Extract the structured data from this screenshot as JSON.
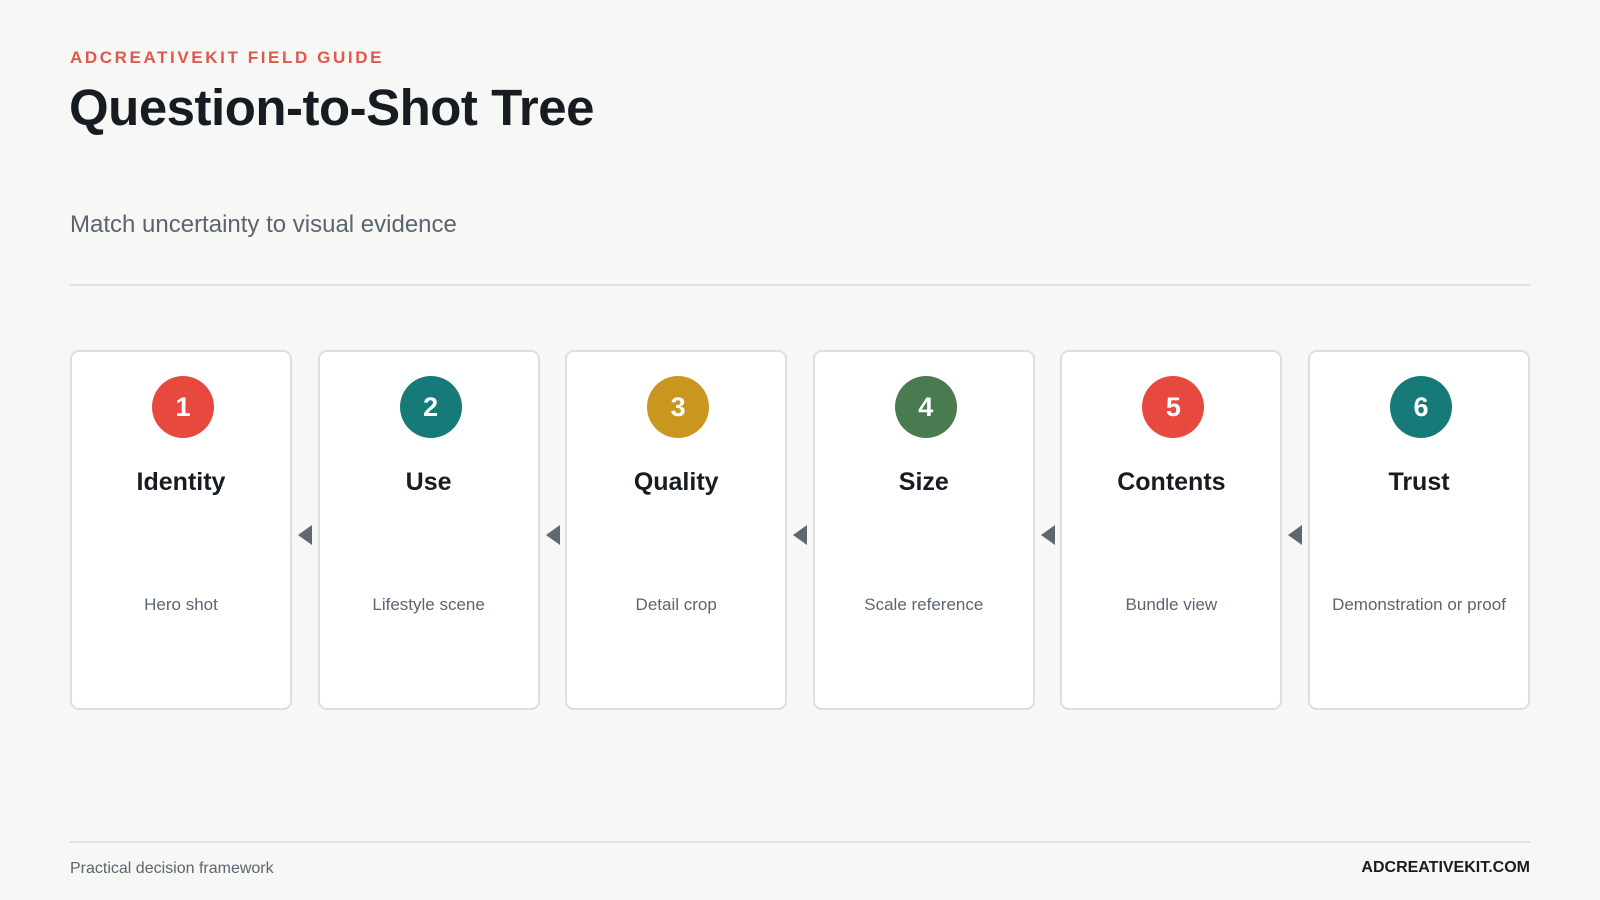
{
  "header": {
    "kicker": "ADCREATIVEKIT FIELD GUIDE",
    "title": "Question-to-Shot Tree",
    "subtitle": "Match uncertainty to visual evidence"
  },
  "colors": {
    "accent": "#e2574c",
    "red": "#e8493f",
    "teal": "#167a78",
    "gold": "#c9961f",
    "green": "#4a7a4f"
  },
  "steps": [
    {
      "number": "1",
      "title": "Identity",
      "description": "Hero shot",
      "color": "#e8493f"
    },
    {
      "number": "2",
      "title": "Use",
      "description": "Lifestyle scene",
      "color": "#167a78"
    },
    {
      "number": "3",
      "title": "Quality",
      "description": "Detail crop",
      "color": "#c9961f"
    },
    {
      "number": "4",
      "title": "Size",
      "description": "Scale reference",
      "color": "#4a7a4f"
    },
    {
      "number": "5",
      "title": "Contents",
      "description": "Bundle view",
      "color": "#e8493f"
    },
    {
      "number": "6",
      "title": "Trust",
      "description": "Demonstration or proof",
      "color": "#167a78"
    }
  ],
  "connector_icon": "left-triangle-arrow-icon",
  "footer": {
    "left": "Practical decision framework",
    "right": "ADCREATIVEKIT.COM"
  }
}
